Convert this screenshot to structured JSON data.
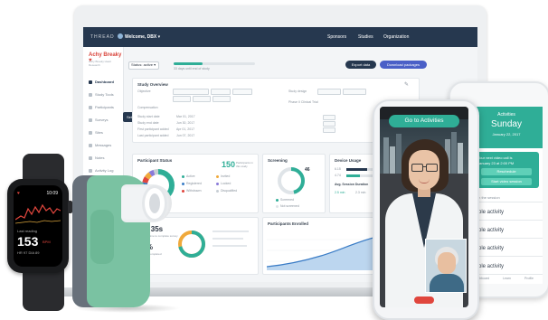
{
  "dashboard": {
    "brand": "THREAD",
    "welcome": "Welcome, DBX ▾",
    "nav": [
      "Sponsors",
      "Studies",
      "Organization"
    ],
    "study_title": "Achy Breaky ♥",
    "study_subtitle": "Achy Breaky Heart Research",
    "sidebar": [
      "Dashboard",
      "Study Tools",
      "Participants",
      "Surveys",
      "Sites",
      "Messages",
      "Notes",
      "Activity Log"
    ],
    "tooltip": "Set up TelehealthO",
    "select_label": "Status: active ▾",
    "progress_text": "33 days until end of study",
    "progress": 0.35,
    "btn_export": "Export data",
    "btn_download": "Download packages",
    "overview_title": "Study Overview",
    "overview_fields": [
      {
        "label": "Objective",
        "value": ""
      },
      {
        "label": "Study start date",
        "value": "Mar 01, 2017"
      },
      {
        "label": "Study end date",
        "value": "Jun 30, 2017"
      },
      {
        "label": "First participant added",
        "value": "Apr 01, 2017"
      },
      {
        "label": "Last participant added",
        "value": "Jun 07, 2017"
      }
    ],
    "compensation_label": "Compensation",
    "study_design_label": "Study design",
    "study_design_value": "Phase II Clinical Trial",
    "participant_status": {
      "title": "Participant Status",
      "total": "150",
      "total_label": "Participants in this study",
      "legend": [
        "Active",
        "Registered",
        "Withdrawn",
        "Invited",
        "Locked",
        "Disqualified"
      ],
      "colors": [
        "#2fae97",
        "#3a7cc6",
        "#e0463d",
        "#f0a93b",
        "#8a7ad8",
        "#c7ced4"
      ],
      "values": [
        0.62,
        0.16,
        0.06,
        0.06,
        0.05,
        0.05
      ]
    },
    "screening": {
      "title": "Screening",
      "value": "46",
      "legend": [
        "Screened",
        "Not screened"
      ],
      "fraction": 0.46
    },
    "device_usage": {
      "title": "Device Usage",
      "items": [
        "6.15",
        "4.74"
      ],
      "fill": [
        0.72,
        0.48
      ],
      "avg_label": "Avg. Session Duration",
      "avg_values": [
        "2.5 min",
        "2.3 min"
      ]
    },
    "time_card": {
      "time": "4m 35s",
      "time_label": "Average time to complete survey",
      "pct": "94%",
      "pct_label": "Surveys completed"
    },
    "enrolled": {
      "title": "Participants Enrolled"
    }
  },
  "watch": {
    "time": "10:09",
    "reading": "153",
    "unit": "BPM",
    "sub": "Last reading",
    "status": "HR 97 DIA 89"
  },
  "video_call": {
    "button": "Go to Activities"
  },
  "activities_phone": {
    "header": "Activities",
    "day": "Sunday",
    "date": "January 22, 2017",
    "notice": "Your next video call is",
    "notice_date": "January 23 at 2:00 PM",
    "btn_reschedule": "Reschedule",
    "btn_start": "Start video session",
    "btn_join": "Join the session",
    "items": [
      "mple activity",
      "mple activity",
      "mple activity",
      "mple activity"
    ],
    "tabs": [
      "Dashboard",
      "Learn",
      "Profile"
    ]
  }
}
